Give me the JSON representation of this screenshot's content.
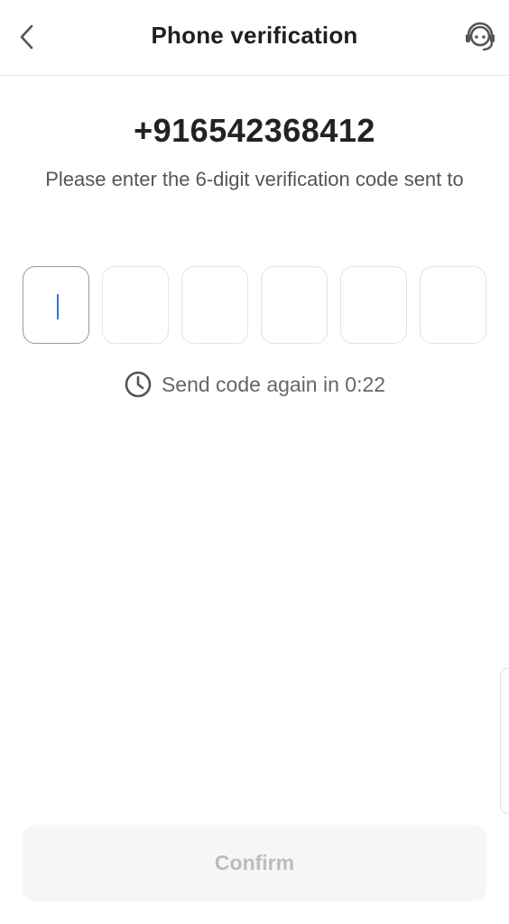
{
  "header": {
    "title": "Phone verification",
    "back_icon": "chevron-left-icon",
    "support_icon": "headset-support-icon"
  },
  "verification": {
    "phone_number": "+916542368412",
    "instruction": "Please enter the 6-digit verification code sent to",
    "code_length": 6,
    "code_digits": [
      "",
      "",
      "",
      "",
      "",
      ""
    ],
    "active_index": 0
  },
  "resend": {
    "icon": "clock-icon",
    "text": "Send code again in 0:22"
  },
  "confirm": {
    "label": "Confirm",
    "enabled": false
  },
  "colors": {
    "caret": "#3b6fd8",
    "confirm_bg_disabled": "#f7f6f4",
    "confirm_text_disabled": "#bdbcbb"
  }
}
